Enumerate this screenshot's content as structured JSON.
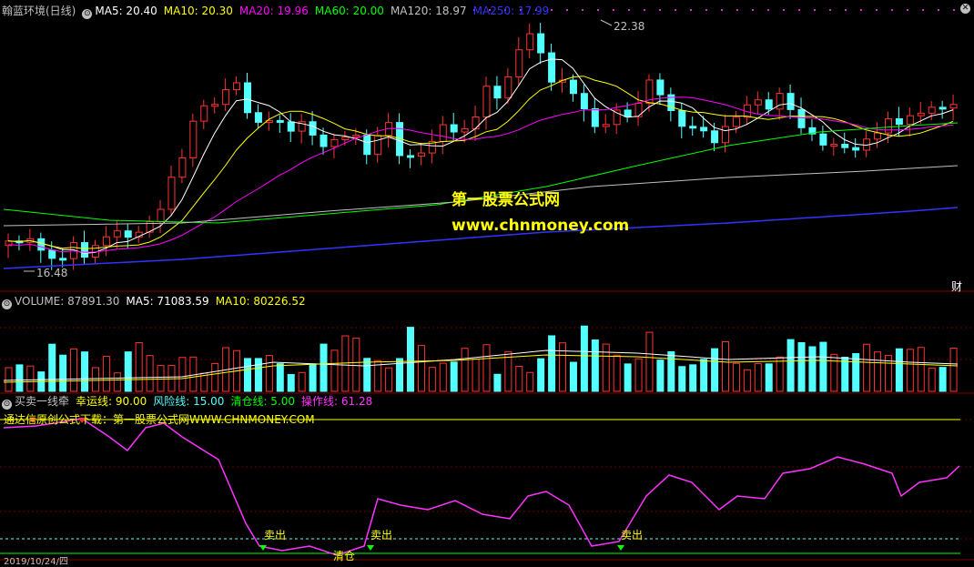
{
  "main_panel": {
    "stock": "翰蓝环境(日线)",
    "indicators": [
      {
        "label": "MA5: 20.40",
        "color": "#ffffff"
      },
      {
        "label": "MA10: 20.30",
        "color": "#ffff00"
      },
      {
        "label": "MA20: 19.96",
        "color": "#ff00ff"
      },
      {
        "label": "MA60: 20.00",
        "color": "#00ff00"
      },
      {
        "label": "MA120: 18.97",
        "color": "#c0c0c0"
      },
      {
        "label": "MA250: 17.99",
        "color": "#3333ff"
      }
    ],
    "high_label": "22.38",
    "low_label": "16.48",
    "corner_label": "财",
    "watermark_cn": "第一股票公式网",
    "watermark_url": "www.chnmoney.com"
  },
  "volume_panel": {
    "title": "VOLUME: 87891.30",
    "ma5": "MA5: 71083.59",
    "ma10": "MA10: 80226.52"
  },
  "indicator_panel": {
    "title": "买卖一线牵",
    "lines": [
      {
        "label": "幸运线: 90.00",
        "color": "#ffff00"
      },
      {
        "label": "风险线: 15.00",
        "color": "#55ffff"
      },
      {
        "label": "清仓线: 5.00",
        "color": "#00ff00"
      },
      {
        "label": "操作线: 61.28",
        "color": "#ff33ff"
      }
    ],
    "notice": "通达信原创公式下载：第一股票公式网WWW.CHNMONEY.COM",
    "sell_labels": [
      "卖出",
      "卖出",
      "卖出"
    ],
    "clear_label": "清仓"
  },
  "footer": {
    "date": "2019/10/24/四"
  }
}
